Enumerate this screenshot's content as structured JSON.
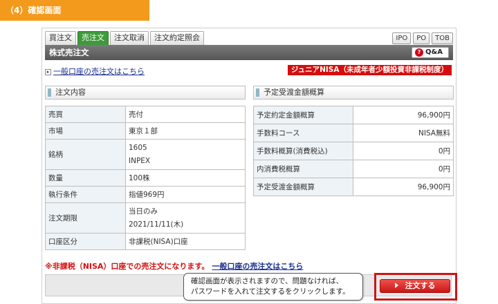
{
  "step": {
    "label": "（4）確認画面"
  },
  "tabs": [
    {
      "label": "買注文",
      "active": false
    },
    {
      "label": "売注文",
      "active": true
    },
    {
      "label": "注文取消",
      "active": false
    },
    {
      "label": "注文約定照会",
      "active": false
    }
  ],
  "right_tabs": [
    "IPO",
    "PO",
    "TOB"
  ],
  "title": "株式売注文",
  "qa_label": "Q&A",
  "qa_icon": "help-circle-icon",
  "general_link": "一般口座の売注文はこちら",
  "junior_badge": "ジュニアNISA（未成年者少額投資非課税制度）",
  "order": {
    "heading": "注文内容",
    "rows": [
      {
        "label": "売買",
        "value": "売付"
      },
      {
        "label": "市場",
        "value": "東京１部"
      },
      {
        "label": "銘柄",
        "value1": "1605",
        "value2": "INPEX"
      },
      {
        "label": "数量",
        "value": "100株"
      },
      {
        "label": "執行条件",
        "value": "指値969円"
      },
      {
        "label": "注文期限",
        "value1": "当日のみ",
        "value2": "2021/11/11(木)"
      },
      {
        "label": "口座区分",
        "value": "非課税(NISA)口座"
      }
    ]
  },
  "settlement": {
    "heading": "予定受渡金額概算",
    "rows": [
      {
        "label": "予定約定金額概算",
        "value": "96,900円"
      },
      {
        "label": "手数料コース",
        "value": "NISA無料"
      },
      {
        "label": "手数料概算(消費税込)",
        "value": "0円"
      },
      {
        "label": "内消費税概算",
        "value": "0円"
      },
      {
        "label": "予定受渡金額概算",
        "value": "96,900円"
      }
    ]
  },
  "notice": {
    "text": "※非課税（NISA）口座での売注文になります。",
    "link": "一般口座の売注文はこちら"
  },
  "submit_label": "注文する",
  "callout": {
    "line1": "確認画面が表示されますので、問題なければ、",
    "line2": "パスワードを入れて注文するをクリックします。"
  },
  "colors": {
    "step_header": "#f39a1c",
    "active_tab": "#3f9a3a",
    "title_bar": "#666666",
    "badge_red": "#d40e0e",
    "submit_red": "#d8231f",
    "link_blue": "#1a2e8f"
  }
}
